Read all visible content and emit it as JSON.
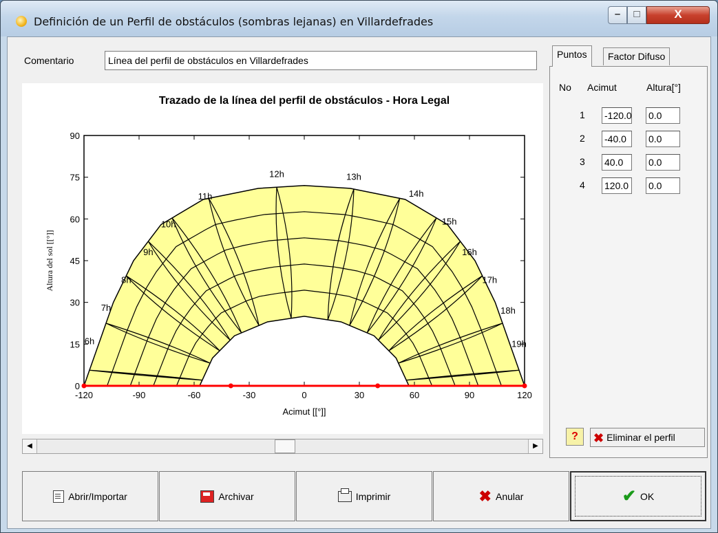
{
  "window": {
    "title": "Definición de un Perfil de obstáculos (sombras lejanas) en Villardefrades",
    "min_glyph": "–",
    "max_glyph": "□",
    "close_glyph": "X"
  },
  "comment": {
    "label": "Comentario",
    "value": "Línea del perfil de obstáculos en Villardefrades"
  },
  "tabs": [
    "Puntos",
    "Factor Difuso"
  ],
  "points_table": {
    "headers": [
      "No",
      "Acimut",
      "Altura[°]"
    ],
    "rows": [
      {
        "no": "1",
        "acimut": "-120.0",
        "altura": "0.0"
      },
      {
        "no": "2",
        "acimut": "-40.0",
        "altura": "0.0"
      },
      {
        "no": "3",
        "acimut": "40.0",
        "altura": "0.0"
      },
      {
        "no": "4",
        "acimut": "120.0",
        "altura": "0.0"
      }
    ]
  },
  "panel_buttons": {
    "help": "?",
    "delete_profile": "Eliminar el perfil"
  },
  "scrollbar": {
    "left_glyph": "◀",
    "right_glyph": "▶"
  },
  "buttons": {
    "open": "Abrir/Importar",
    "save": "Archivar",
    "print": "Imprimir",
    "cancel": "Anular",
    "ok": "OK"
  },
  "colors": {
    "sun_region": "#ffff99",
    "profile_line": "#ff0000",
    "grid": "#000000"
  },
  "chart_data": {
    "type": "line",
    "title": "Trazado de la línea del perfil de obstáculos - Hora Legal",
    "xlabel": "Acimut [[°]]",
    "ylabel": "Altura del sol [[°]]",
    "xlim": [
      -120,
      120
    ],
    "ylim": [
      0,
      90
    ],
    "xticks": [
      -120,
      -90,
      -60,
      -30,
      0,
      30,
      60,
      90,
      120
    ],
    "yticks": [
      0,
      15,
      30,
      45,
      60,
      75,
      90
    ],
    "series": [
      {
        "values": [
          [
            -120,
            0
          ],
          [
            -40,
            0
          ],
          [
            40,
            0
          ],
          [
            120,
            0
          ]
        ]
      }
    ],
    "sun_path_summer": [
      [
        -120,
        0
      ],
      [
        -112,
        15
      ],
      [
        -104,
        30
      ],
      [
        -93,
        45
      ],
      [
        -78,
        58
      ],
      [
        -55,
        67
      ],
      [
        -25,
        71
      ],
      [
        0,
        72
      ],
      [
        25,
        71
      ],
      [
        55,
        67
      ],
      [
        78,
        58
      ],
      [
        93,
        45
      ],
      [
        104,
        30
      ],
      [
        112,
        15
      ],
      [
        120,
        0
      ]
    ],
    "sun_path_winter": [
      [
        -57,
        0
      ],
      [
        -50,
        10
      ],
      [
        -38,
        18
      ],
      [
        -20,
        23
      ],
      [
        0,
        25
      ],
      [
        20,
        23
      ],
      [
        38,
        18
      ],
      [
        50,
        10
      ],
      [
        57,
        0
      ]
    ],
    "hour_labels": [
      {
        "label": "6h",
        "x": -117,
        "y": 15
      },
      {
        "label": "7h",
        "x": -108,
        "y": 27
      },
      {
        "label": "8h",
        "x": -97,
        "y": 37
      },
      {
        "label": "9h",
        "x": -85,
        "y": 47
      },
      {
        "label": "10h",
        "x": -74,
        "y": 57
      },
      {
        "label": "11h",
        "x": -54,
        "y": 67
      },
      {
        "label": "12h",
        "x": -15,
        "y": 75
      },
      {
        "label": "13h",
        "x": 27,
        "y": 74
      },
      {
        "label": "14h",
        "x": 61,
        "y": 68
      },
      {
        "label": "15h",
        "x": 79,
        "y": 58
      },
      {
        "label": "16h",
        "x": 90,
        "y": 47
      },
      {
        "label": "17h",
        "x": 101,
        "y": 37
      },
      {
        "label": "18h",
        "x": 111,
        "y": 26
      },
      {
        "label": "19h",
        "x": 117,
        "y": 14
      }
    ]
  }
}
